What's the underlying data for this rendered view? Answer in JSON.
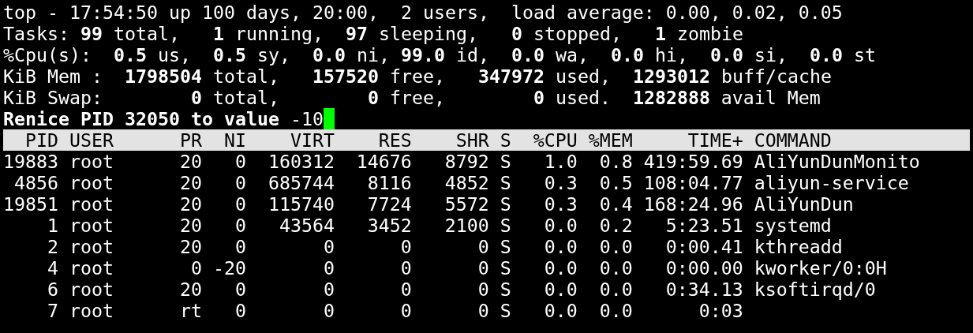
{
  "summary": [
    "top - 17:54:50 up 100 days, 20:00,  2 users,  load average: 0.00, 0.02, 0.05",
    "Tasks: **99** total,   **1** running,  **97** sleeping,   **0** stopped,   **1** zombie",
    "%Cpu(s):  **0.5** us,  **0.5** sy,  **0.0** ni, **99.0** id,  **0.0** wa,  **0.0** hi,  **0.0** si,  **0.0** st",
    "KiB Mem :  **1798504** total,   **157520** free,   **347972** used,  **1293012** buff/cache",
    "KiB Swap:        **0** total,        **0** free,        **0** used.  **1282888** avail Mem"
  ],
  "prompt": {
    "text": "**Renice PID 32050 to value** -10",
    "cursor": true
  },
  "table": {
    "columns": [
      "PID",
      "USER",
      "PR",
      "NI",
      "VIRT",
      "RES",
      "SHR",
      "S",
      "%CPU",
      "%MEM",
      "TIME+",
      "COMMAND"
    ],
    "rows": [
      [
        "19883",
        "root",
        "20",
        "0",
        "160312",
        "14676",
        "8792",
        "S",
        "1.0",
        "0.8",
        "419:59.69",
        "AliYunDunMonito"
      ],
      [
        "4856",
        "root",
        "20",
        "0",
        "685744",
        "8116",
        "4852",
        "S",
        "0.3",
        "0.5",
        "108:04.77",
        "aliyun-service"
      ],
      [
        "19851",
        "root",
        "20",
        "0",
        "115740",
        "7724",
        "5572",
        "S",
        "0.3",
        "0.4",
        "168:24.96",
        "AliYunDun"
      ],
      [
        "1",
        "root",
        "20",
        "0",
        "43564",
        "3452",
        "2100",
        "S",
        "0.0",
        "0.2",
        "5:23.51",
        "systemd"
      ],
      [
        "2",
        "root",
        "20",
        "0",
        "0",
        "0",
        "0",
        "S",
        "0.0",
        "0.0",
        "0:00.41",
        "kthreadd"
      ],
      [
        "4",
        "root",
        "0",
        "-20",
        "0",
        "0",
        "0",
        "S",
        "0.0",
        "0.0",
        "0:00.00",
        "kworker/0:0H"
      ],
      [
        "6",
        "root",
        "20",
        "0",
        "0",
        "0",
        "0",
        "S",
        "0.0",
        "0.0",
        "0:34.13",
        "ksoftirqd/0"
      ],
      [
        "7",
        "root",
        "rt",
        "0",
        "0",
        "0",
        "0",
        "S",
        "0.0",
        "0.0",
        "0:03"
      ]
    ]
  }
}
